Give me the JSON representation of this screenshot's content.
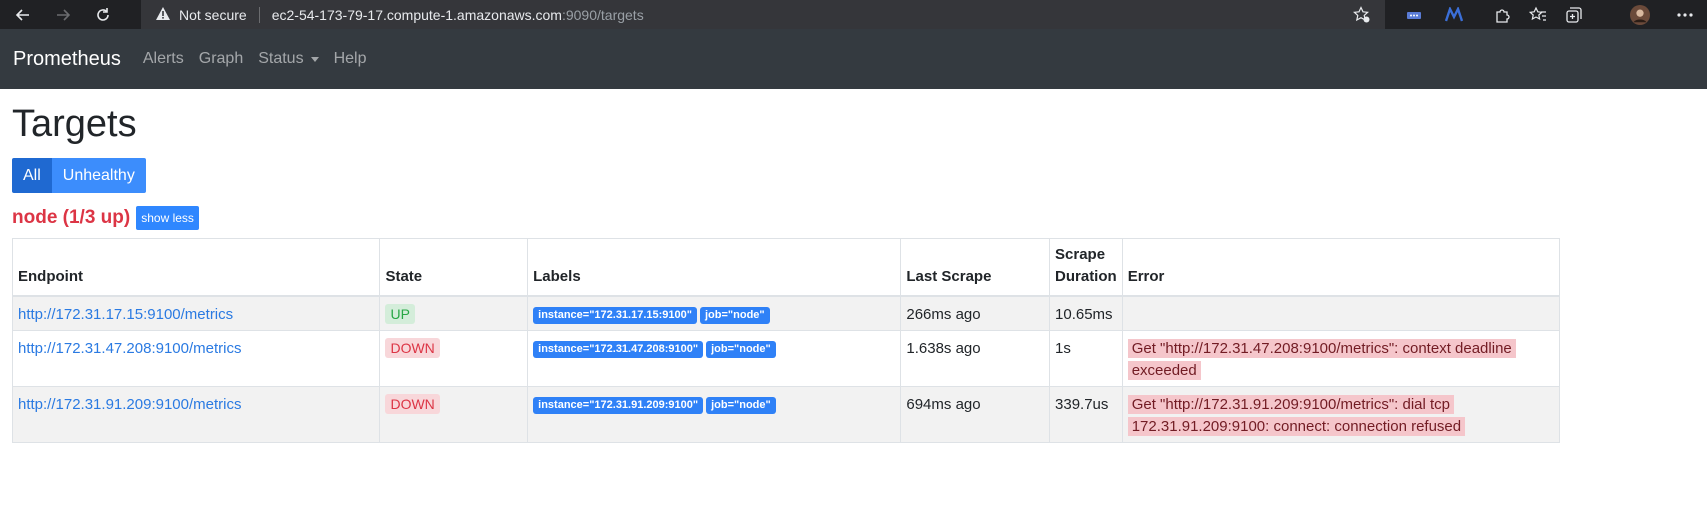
{
  "browser": {
    "security_label": "Not secure",
    "url_host": "ec2-54-173-79-17.compute-1.amazonaws.com",
    "url_path": ":9090/targets"
  },
  "navbar": {
    "brand": "Prometheus",
    "links": [
      "Alerts",
      "Graph",
      "Status",
      "Help"
    ]
  },
  "page": {
    "title": "Targets",
    "filters": {
      "all": "All",
      "unhealthy": "Unhealthy"
    }
  },
  "job": {
    "title": "node (1/3 up)",
    "toggle_label": "show less"
  },
  "table": {
    "headers": {
      "endpoint": "Endpoint",
      "state": "State",
      "labels": "Labels",
      "last_scrape": "Last Scrape",
      "scrape_duration_1": "Scrape",
      "scrape_duration_2": "Duration",
      "error": "Error"
    },
    "rows": [
      {
        "endpoint": "http://172.31.17.15:9100/metrics",
        "state": "UP",
        "label_instance": "instance=\"172.31.17.15:9100\"",
        "label_job": "job=\"node\"",
        "last_scrape": "266ms ago",
        "duration": "10.65ms",
        "error": ""
      },
      {
        "endpoint": "http://172.31.47.208:9100/metrics",
        "state": "DOWN",
        "label_instance": "instance=\"172.31.47.208:9100\"",
        "label_job": "job=\"node\"",
        "last_scrape": "1.638s ago",
        "duration": "1s",
        "error": "Get \"http://172.31.47.208:9100/metrics\": context deadline exceeded"
      },
      {
        "endpoint": "http://172.31.91.209:9100/metrics",
        "state": "DOWN",
        "label_instance": "instance=\"172.31.91.209:9100\"",
        "label_job": "job=\"node\"",
        "last_scrape": "694ms ago",
        "duration": "339.7us",
        "error": "Get \"http://172.31.91.209:9100/metrics\": dial tcp 172.31.91.209:9100: connect: connection refused"
      }
    ]
  },
  "colors": {
    "navbar_bg": "#343a40",
    "job_title": "#dc3545",
    "primary": "#3c8dfc",
    "link": "#2a7ae2"
  }
}
